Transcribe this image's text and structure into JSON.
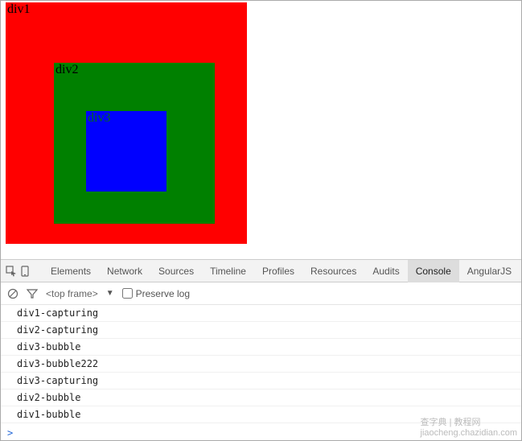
{
  "demo": {
    "div1_label": "div1",
    "div2_label": "div2",
    "div3_label": "div3"
  },
  "devtools": {
    "tabs": [
      "Elements",
      "Network",
      "Sources",
      "Timeline",
      "Profiles",
      "Resources",
      "Audits",
      "Console",
      "AngularJS"
    ],
    "active_tab_index": 7,
    "frame_selector": "<top frame>",
    "preserve_log_label": "Preserve log",
    "preserve_log_checked": false,
    "log_lines": [
      "div1-capturing",
      "div2-capturing",
      "div3-bubble",
      "div3-bubble222",
      "div3-capturing",
      "div2-bubble",
      "div1-bubble"
    ],
    "prompt_symbol": ">"
  },
  "watermark": {
    "line1": "查字典 | 教程网",
    "line2": "jiaocheng.chazidian.com"
  }
}
